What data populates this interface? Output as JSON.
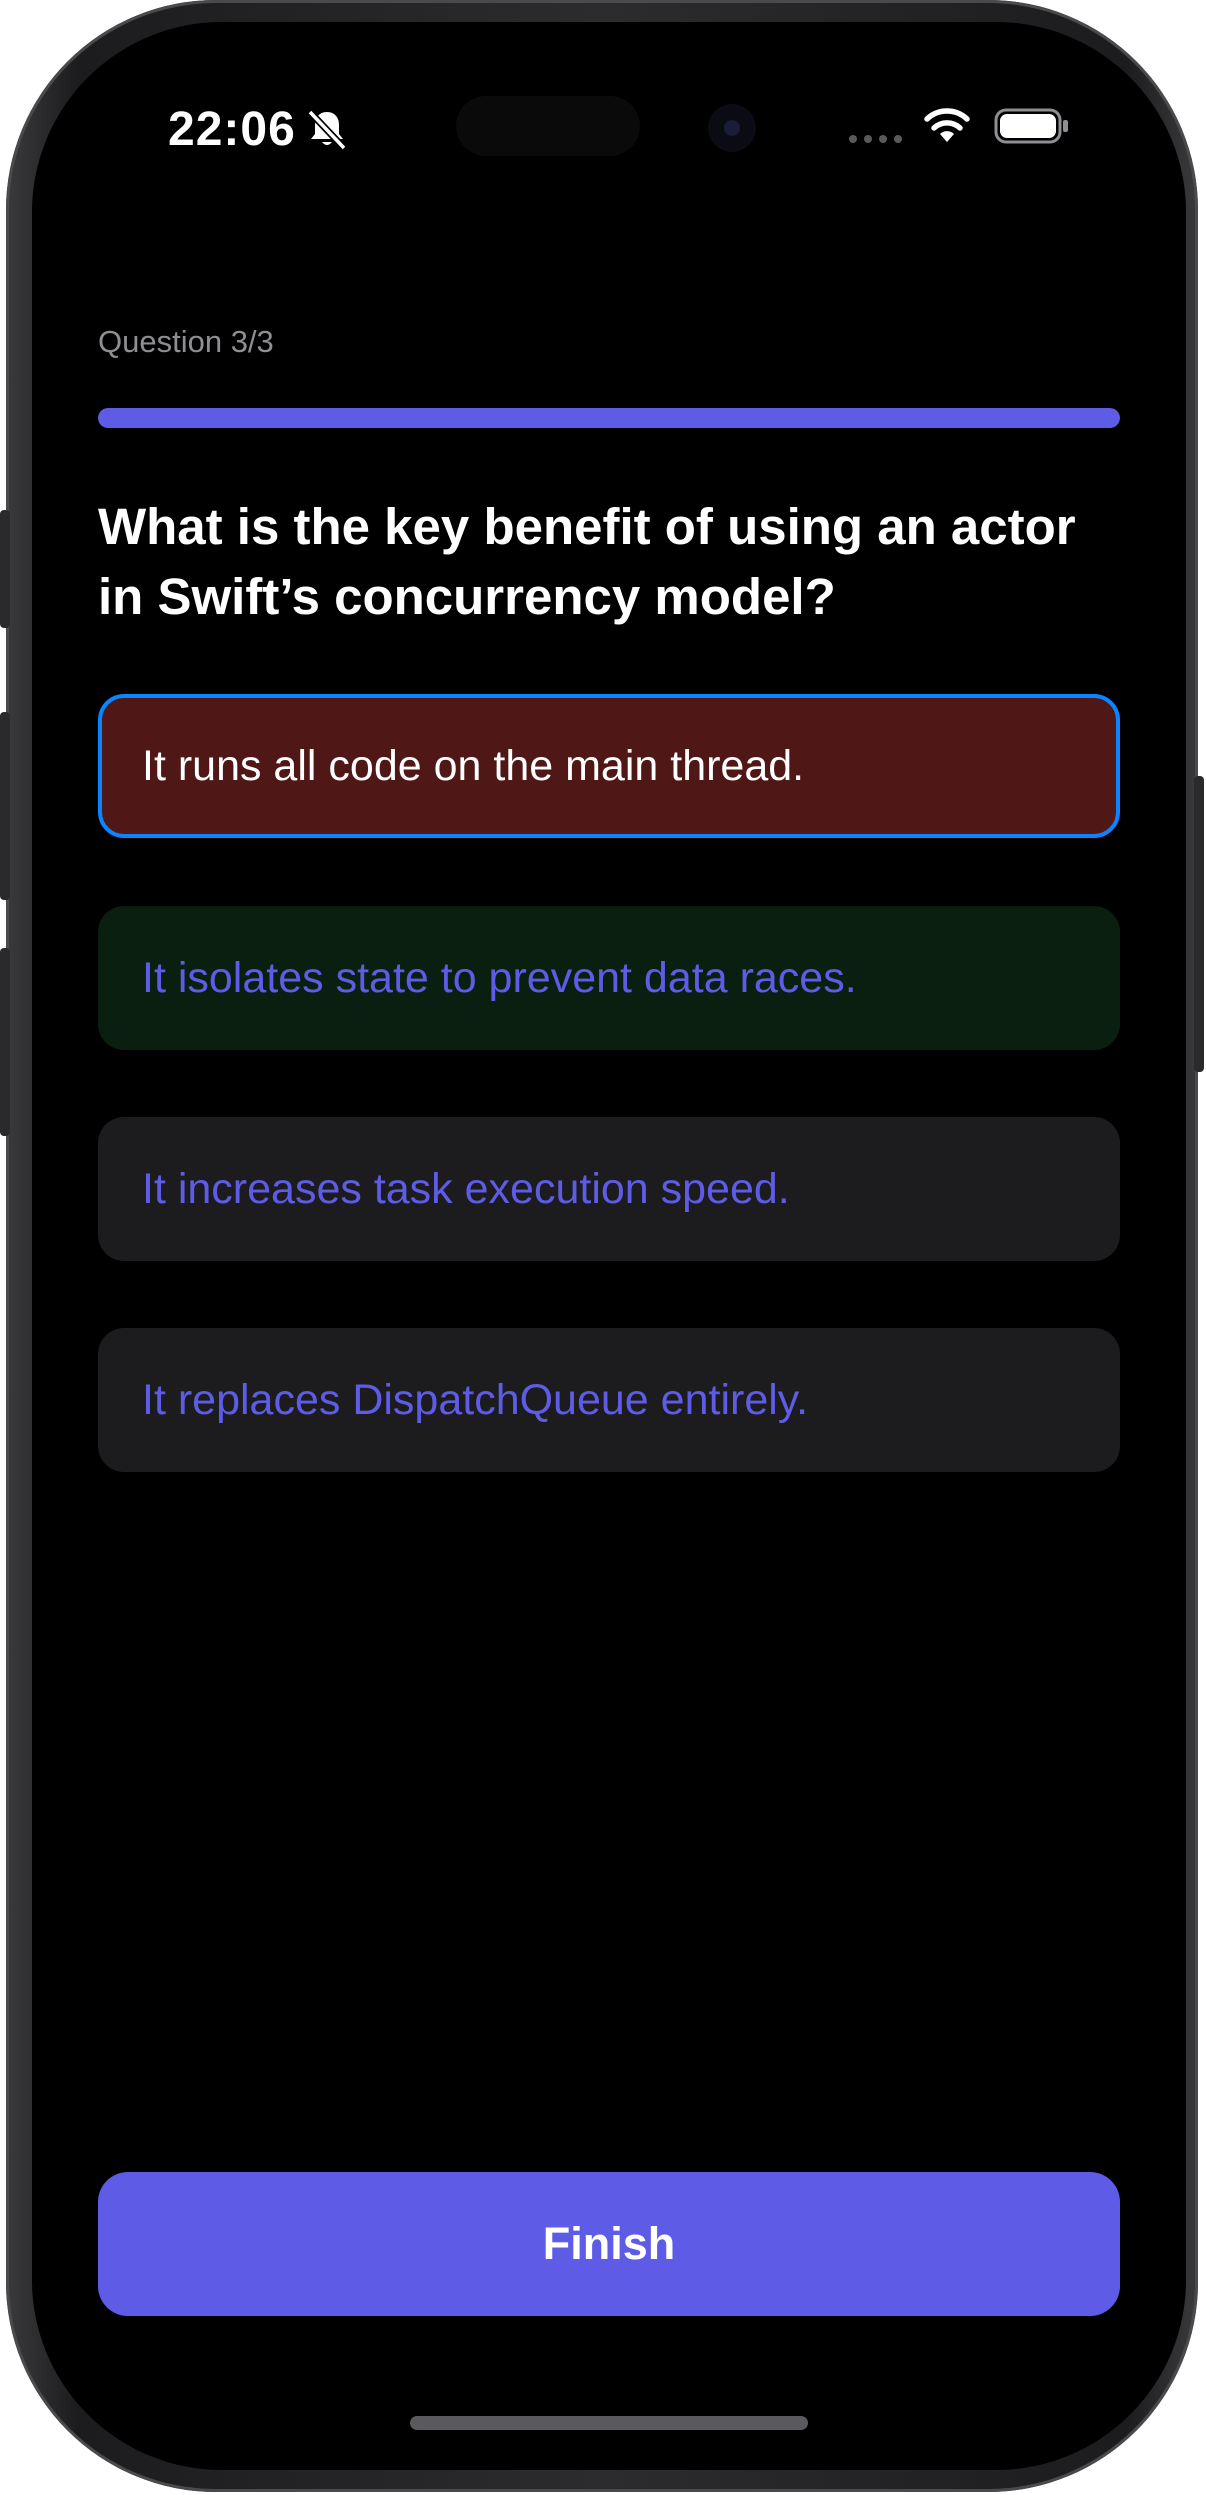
{
  "status_bar": {
    "time": "22:06",
    "icons": [
      "bell-slash-icon",
      "cellular-signal-icon",
      "wifi-icon",
      "battery-icon"
    ]
  },
  "quiz": {
    "counter": "Question 3/3",
    "progress_fraction": 1.0,
    "question": "What is the key benefit of using an actor in Swift’s concurrency model?",
    "options": [
      {
        "label": "It runs all code on the main thread.",
        "state": "selected-incorrect"
      },
      {
        "label": "It isolates state to prevent data races.",
        "state": "correct"
      },
      {
        "label": "It increases task execution speed.",
        "state": "default"
      },
      {
        "label": "It replaces DispatchQueue entirely.",
        "state": "default"
      }
    ],
    "finish_label": "Finish"
  },
  "colors": {
    "accent": "#5e5ce6",
    "incorrect_background": "#4f1716",
    "correct_background": "#0a1f10",
    "selection_border": "#0a84ff",
    "option_background": "#1c1c1e",
    "screen_background": "#000000"
  }
}
